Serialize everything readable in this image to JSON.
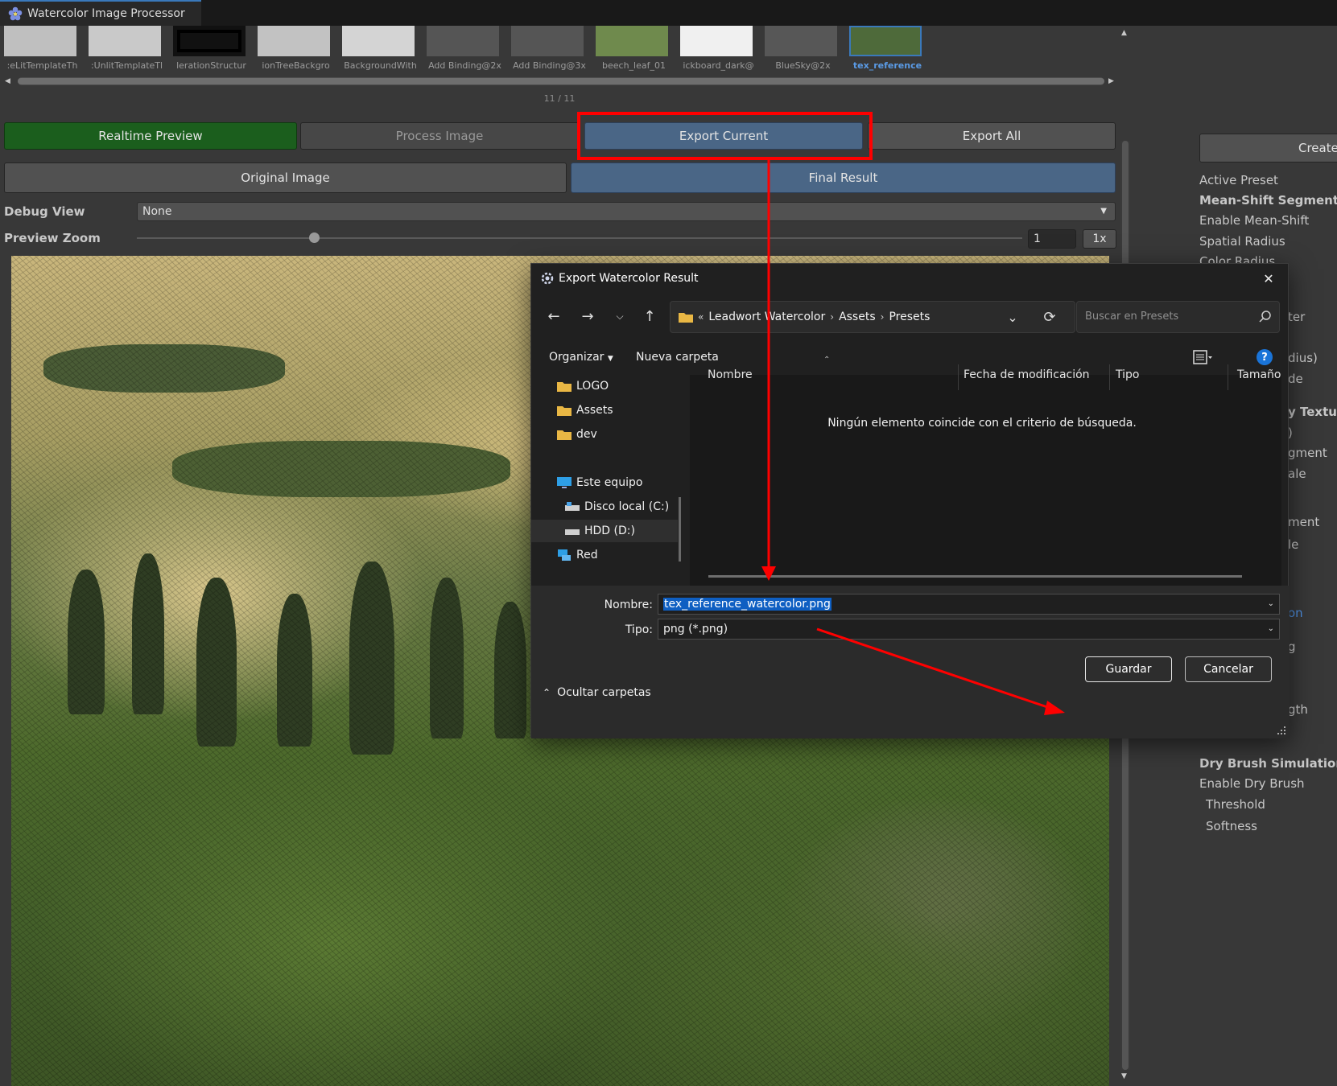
{
  "window": {
    "title": "Watercolor Image Processor"
  },
  "thumbnails": [
    {
      "label": ":eLitTemplateTh",
      "selected": false
    },
    {
      "label": ":UnlitTemplateTl",
      "selected": false
    },
    {
      "label": "lerationStructur",
      "selected": false
    },
    {
      "label": "ionTreeBackgro",
      "selected": false
    },
    {
      "label": "BackgroundWith",
      "selected": false
    },
    {
      "label": "Add Binding@2x",
      "selected": false
    },
    {
      "label": "Add Binding@3x",
      "selected": false
    },
    {
      "label": "beech_leaf_01",
      "selected": false
    },
    {
      "label": "ickboard_dark@",
      "selected": false
    },
    {
      "label": "BlueSky@2x",
      "selected": false
    },
    {
      "label": "tex_reference",
      "selected": true
    }
  ],
  "thumb_counter": "11 / 11",
  "toolbar": {
    "realtime_preview": "Realtime Preview",
    "process_image": "Process Image",
    "export_current": "Export Current",
    "export_all": "Export All"
  },
  "view_tabs": {
    "original": "Original Image",
    "final": "Final Result"
  },
  "debug_view": {
    "label": "Debug View",
    "value": "None"
  },
  "preview_zoom": {
    "label": "Preview Zoom",
    "value": "1",
    "button": "1x",
    "slider_fraction": 0.2
  },
  "inspector": {
    "create_button": "Create",
    "rows": [
      {
        "text": "Active Preset",
        "bold": false
      },
      {
        "text": "Mean-Shift Segmentatio",
        "bold": true
      },
      {
        "text": "Enable Mean-Shift",
        "bold": false
      },
      {
        "text": "Spatial Radius",
        "bold": false
      },
      {
        "text": "Color Radius",
        "bold": false
      }
    ],
    "fragments": [
      "ter",
      "dius)",
      "de",
      "y Texture",
      ")",
      "gment",
      "ale",
      "ment",
      "le",
      "on",
      "g",
      "gth"
    ],
    "rows_bottom": [
      {
        "text": "Dry Brush Simulation",
        "bold": true
      },
      {
        "text": "Enable Dry Brush",
        "bold": false
      },
      {
        "text": "Threshold",
        "bold": false
      },
      {
        "text": "Softness",
        "bold": false
      }
    ]
  },
  "dialog": {
    "title": "Export Watercolor Result",
    "breadcrumb": [
      "Leadwort Watercolor",
      "Assets",
      "Presets"
    ],
    "search_placeholder": "Buscar en Presets",
    "organize": "Organizar",
    "new_folder": "Nueva carpeta",
    "help": "?",
    "nav": [
      {
        "label": "LOGO",
        "icon": "folder-icon",
        "indent": 0
      },
      {
        "label": "Assets",
        "icon": "folder-icon",
        "indent": 0
      },
      {
        "label": "dev",
        "icon": "folder-icon",
        "indent": 0
      },
      {
        "label": "Este equipo",
        "icon": "computer-icon",
        "indent": 0
      },
      {
        "label": "Disco local (C:)",
        "icon": "drive-icon",
        "indent": 1
      },
      {
        "label": "HDD (D:)",
        "icon": "drive-icon",
        "indent": 1,
        "selected": true
      },
      {
        "label": "Red",
        "icon": "network-icon",
        "indent": 0
      }
    ],
    "columns": [
      "Nombre",
      "Fecha de modificación",
      "Tipo",
      "Tamaño"
    ],
    "empty_message": "Ningún elemento coincide con el criterio de búsqueda.",
    "name_label": "Nombre:",
    "name_value": "tex_reference_watercolor.png",
    "type_label": "Tipo:",
    "type_value": "png (*.png)",
    "hide_folders": "Ocultar carpetas",
    "save": "Guardar",
    "cancel": "Cancelar"
  },
  "colors": {
    "accent_blue": "#4a6686",
    "realtime_green": "#1b5e1d",
    "annotation_red": "#ff0000",
    "selection_blue": "#0f5fc2"
  }
}
